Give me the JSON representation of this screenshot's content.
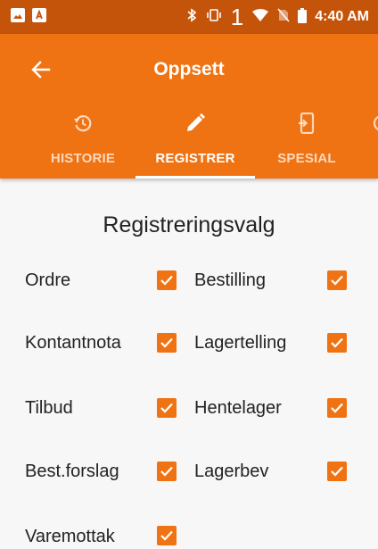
{
  "status_bar": {
    "time": "4:40 AM",
    "signal_digit": "1",
    "icons": [
      "image-icon",
      "a-icon",
      "bluetooth-icon",
      "vibrate-icon",
      "wifi-icon",
      "no-sim-icon",
      "battery-icon"
    ]
  },
  "app_bar": {
    "title": "Oppsett",
    "back_icon": "arrow-back-icon"
  },
  "tabs": [
    {
      "label": "HISTORIE",
      "icon": "history-icon",
      "active": false
    },
    {
      "label": "REGISTRER",
      "icon": "pencil-icon",
      "active": true
    },
    {
      "label": "SPESIAL",
      "icon": "phone-import-icon",
      "active": false
    }
  ],
  "section": {
    "heading": "Registreringsvalg"
  },
  "options": [
    {
      "label": "Ordre",
      "checked": true
    },
    {
      "label": "Bestilling",
      "checked": true
    },
    {
      "label": "Kontantnota",
      "checked": true
    },
    {
      "label": "Lagertelling",
      "checked": true
    },
    {
      "label": "Tilbud",
      "checked": true
    },
    {
      "label": "Hentelager",
      "checked": true
    },
    {
      "label": "Best.forslag",
      "checked": true
    },
    {
      "label": "Lagerbev",
      "checked": true
    },
    {
      "label": "Varemottak",
      "checked": true
    }
  ],
  "colors": {
    "accent": "#f07313",
    "status_bar": "#c5540b",
    "background": "#f7f7f7"
  }
}
